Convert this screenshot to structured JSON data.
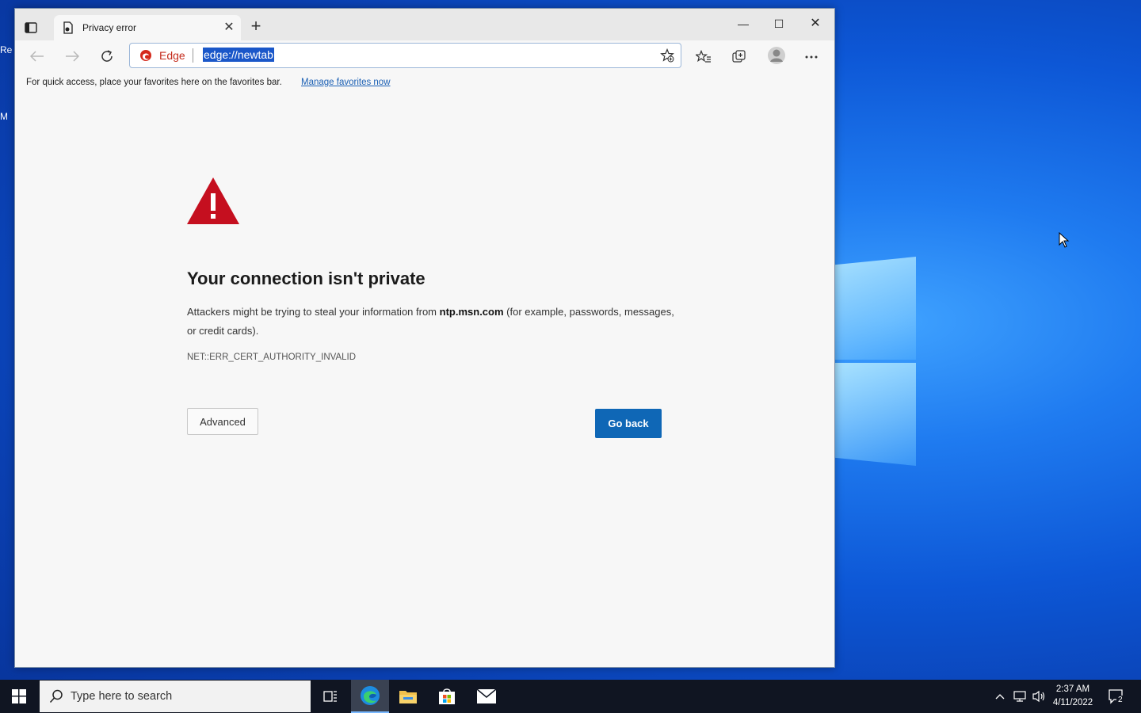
{
  "desktop": {
    "stub_labels": [
      "Re",
      "M"
    ]
  },
  "browser": {
    "tab": {
      "title": "Privacy error"
    },
    "address": {
      "site_label": "Edge",
      "url": "edge://newtab"
    },
    "favorites_bar": {
      "message": "For quick access, place your favorites here on the favorites bar.",
      "link": "Manage favorites now"
    },
    "error_page": {
      "heading": "Your connection isn't private",
      "desc_prefix": "Attackers might be trying to steal your information from ",
      "desc_host": "ntp.msn.com",
      "desc_suffix": " (for example, passwords, messages, or credit cards).",
      "error_code": "NET::ERR_CERT_AUTHORITY_INVALID",
      "advanced_label": "Advanced",
      "go_back_label": "Go back"
    },
    "icons": [
      "tab-actions-icon",
      "page-icon",
      "close-icon",
      "plus-icon",
      "minimize-icon",
      "maximize-icon",
      "close-window-icon",
      "back-arrow-icon",
      "forward-arrow-icon",
      "refresh-icon",
      "edge-logo-icon",
      "add-favorite-icon",
      "favorites-icon",
      "collections-icon",
      "profile-icon",
      "more-icon",
      "warning-icon"
    ]
  },
  "taskbar": {
    "search_placeholder": "Type here to search",
    "clock_time": "2:37 AM",
    "clock_date": "4/11/2022",
    "notification_count": "2",
    "apps": [
      "task-view",
      "edge",
      "file-explorer",
      "store",
      "mail"
    ]
  },
  "colors": {
    "accent": "#0f67b6",
    "warning": "#c50f1f",
    "taskbar": "#101522"
  }
}
